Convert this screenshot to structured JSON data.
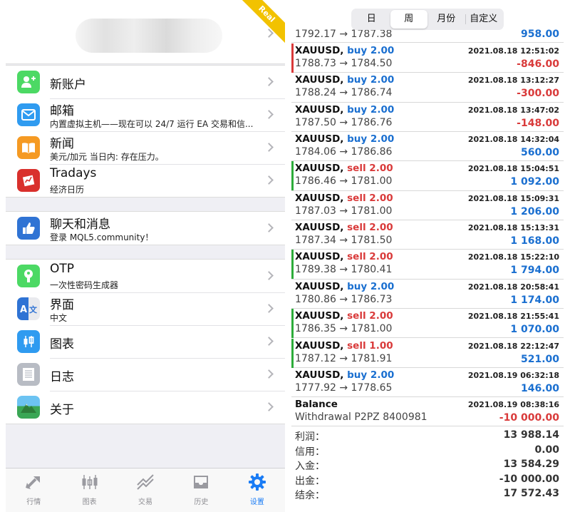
{
  "settings": {
    "account_badge": "Real",
    "rows": [
      {
        "title": "新账户",
        "icon": "add-account-icon",
        "color": "#4cd964"
      },
      {
        "title": "邮箱",
        "subtitle": "内置虚拟主机——现在可以 24/7 运行 EA 交易和信...",
        "icon": "mail-icon",
        "color": "#2f9bf0"
      },
      {
        "title": "新闻",
        "subtitle": "美元/加元 当日内: 存在压力。",
        "icon": "news-book-icon",
        "color": "#f59a23"
      },
      {
        "title": "Tradays",
        "subtitle": "经济日历",
        "icon": "tradays-calendar-icon",
        "color": "#d9302c"
      },
      {
        "title": "聊天和消息",
        "subtitle": "登录 MQL5.community！",
        "icon": "thumbs-up-icon",
        "color": "#2f73d4"
      },
      {
        "title": "OTP",
        "subtitle": "一次性密码生成器",
        "icon": "otp-key-icon",
        "color": "#4cd964"
      },
      {
        "title": "界面",
        "subtitle": "中文",
        "icon": "language-icon",
        "color": "#2f73d4"
      },
      {
        "title": "图表",
        "icon": "chart-candles-icon",
        "color": "#2f9bf0"
      },
      {
        "title": "日志",
        "icon": "journal-icon",
        "color": "#b8bcc4"
      },
      {
        "title": "关于",
        "icon": "about-mountain-icon",
        "color": "#3aa655"
      }
    ]
  },
  "tabbar": [
    {
      "label": "行情",
      "icon": "quotes-arrows-icon"
    },
    {
      "label": "图表",
      "icon": "chart-candles-icon"
    },
    {
      "label": "交易",
      "icon": "trade-chart-icon"
    },
    {
      "label": "历史",
      "icon": "history-inbox-icon"
    },
    {
      "label": "设置",
      "icon": "settings-gear-icon",
      "active": true
    }
  ],
  "history": {
    "segments": [
      "日",
      "周",
      "月份",
      "自定义"
    ],
    "selected_segment": "周",
    "top_row": {
      "prices": "1792.17 → 1787.38",
      "profit": "958.00"
    },
    "deals": [
      {
        "symbol": "XAUUSD,",
        "side": "buy",
        "volume": "2.00",
        "datetime": "2021.08.18 12:51:02",
        "prices": "1788.73 → 1784.50",
        "profit": "-846.00",
        "bar": "#d93a3a"
      },
      {
        "symbol": "XAUUSD,",
        "side": "buy",
        "volume": "2.00",
        "datetime": "2021.08.18 13:12:27",
        "prices": "1788.24 → 1786.74",
        "profit": "-300.00",
        "bar": ""
      },
      {
        "symbol": "XAUUSD,",
        "side": "buy",
        "volume": "2.00",
        "datetime": "2021.08.18 13:47:02",
        "prices": "1787.50 → 1786.76",
        "profit": "-148.00",
        "bar": ""
      },
      {
        "symbol": "XAUUSD,",
        "side": "buy",
        "volume": "2.00",
        "datetime": "2021.08.18 14:32:04",
        "prices": "1784.06 → 1786.86",
        "profit": "560.00",
        "bar": ""
      },
      {
        "symbol": "XAUUSD,",
        "side": "sell",
        "volume": "2.00",
        "datetime": "2021.08.18 15:04:51",
        "prices": "1786.46 → 1781.00",
        "profit": "1 092.00",
        "bar": "#2dac3a"
      },
      {
        "symbol": "XAUUSD,",
        "side": "sell",
        "volume": "2.00",
        "datetime": "2021.08.18 15:09:31",
        "prices": "1787.03 → 1781.00",
        "profit": "1 206.00",
        "bar": ""
      },
      {
        "symbol": "XAUUSD,",
        "side": "sell",
        "volume": "2.00",
        "datetime": "2021.08.18 15:13:31",
        "prices": "1787.34 → 1781.50",
        "profit": "1 168.00",
        "bar": ""
      },
      {
        "symbol": "XAUUSD,",
        "side": "sell",
        "volume": "2.00",
        "datetime": "2021.08.18 15:22:10",
        "prices": "1789.38 → 1780.41",
        "profit": "1 794.00",
        "bar": "#2dac3a"
      },
      {
        "symbol": "XAUUSD,",
        "side": "buy",
        "volume": "2.00",
        "datetime": "2021.08.18 20:58:41",
        "prices": "1780.86 → 1786.73",
        "profit": "1 174.00",
        "bar": ""
      },
      {
        "symbol": "XAUUSD,",
        "side": "sell",
        "volume": "2.00",
        "datetime": "2021.08.18 21:55:41",
        "prices": "1786.35 → 1781.00",
        "profit": "1 070.00",
        "bar": "#2dac3a"
      },
      {
        "symbol": "XAUUSD,",
        "side": "sell",
        "volume": "1.00",
        "datetime": "2021.08.18 22:12:47",
        "prices": "1787.12 → 1781.91",
        "profit": "521.00",
        "bar": "#2dac3a"
      },
      {
        "symbol": "XAUUSD,",
        "side": "buy",
        "volume": "2.00",
        "datetime": "2021.08.19 06:32:18",
        "prices": "1777.92 → 1778.65",
        "profit": "146.00",
        "bar": ""
      },
      {
        "symbol": "Balance",
        "side": "",
        "volume": "",
        "datetime": "2021.08.19 08:38:16",
        "prices": "Withdrawal P2PZ 8400981",
        "profit": "-10 000.00",
        "bar": ""
      }
    ],
    "summary": [
      {
        "label": "利润：",
        "value": "13 988.14"
      },
      {
        "label": "信用：",
        "value": "0.00"
      },
      {
        "label": "入金：",
        "value": "13 584.29"
      },
      {
        "label": "出金：",
        "value": "-10 000.00"
      },
      {
        "label": "结余：",
        "value": "17 572.43"
      }
    ]
  }
}
